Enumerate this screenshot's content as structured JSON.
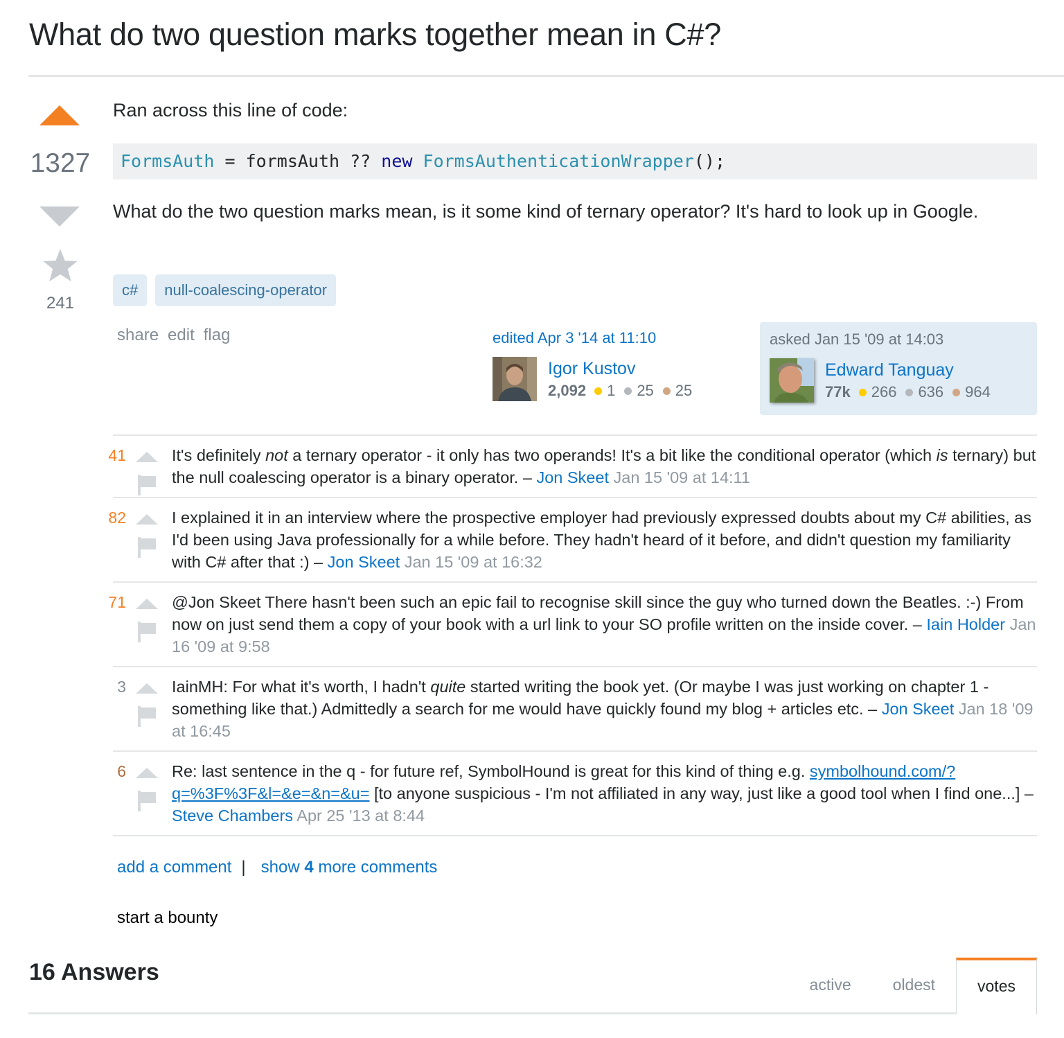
{
  "question": {
    "title": "What do two question marks together mean in C#?",
    "votes": "1327",
    "favorites": "241",
    "intro": "Ran across this line of code:",
    "code": {
      "part1": "FormsAuth",
      "part2": " = formsAuth ?? ",
      "part3": "new",
      "part4": " ",
      "part5": "FormsAuthenticationWrapper",
      "part6": "();"
    },
    "body": "What do the two question marks mean, is it some kind of ternary operator? It's hard to look up in Google.",
    "tags": [
      "c#",
      "null-coalescing-operator"
    ],
    "menu": {
      "share": "share",
      "edit": "edit",
      "flag": "flag"
    },
    "editor": {
      "label": "edited Apr 3 '14 at 11:10",
      "name": "Igor Kustov",
      "reputation": "2,092",
      "gold": "1",
      "silver": "25",
      "bronze": "25"
    },
    "owner": {
      "label": "asked Jan 15 '09 at 14:03",
      "name": "Edward Tanguay",
      "reputation": "77k",
      "gold": "266",
      "silver": "636",
      "bronze": "964"
    }
  },
  "comments": [
    {
      "score": "41",
      "text_a": "It's definitely ",
      "em_a": "not",
      "text_b": " a ternary operator - it only has two operands! It's a bit like the conditional operator (which ",
      "em_b": "is",
      "text_c": " ternary) but the null coalescing operator is a binary operator. – ",
      "user": "Jon Skeet",
      "date": "Jan 15 '09 at 14:11"
    },
    {
      "score": "82",
      "text": "I explained it in an interview where the prospective employer had previously expressed doubts about my C# abilities, as I'd been using Java professionally for a while before. They hadn't heard of it before, and didn't question my familiarity with C# after that :) – ",
      "user": "Jon Skeet",
      "date": "Jan 15 '09 at 16:32"
    },
    {
      "score": "71",
      "text": "@Jon Skeet There hasn't been such an epic fail to recognise skill since the guy who turned down the Beatles. :-) From now on just send them a copy of your book with a url link to your SO profile written on the inside cover. – ",
      "user": "Iain Holder",
      "date": "Jan 16 '09 at 9:58"
    },
    {
      "score": "3",
      "text_a": "IainMH: For what it's worth, I hadn't ",
      "em_a": "quite",
      "text_b": " started writing the book yet. (Or maybe I was just working on chapter 1 - something like that.) Admittedly a search for me would have quickly found my blog + articles etc. – ",
      "user": "Jon Skeet",
      "date": "Jan 18 '09 at 16:45"
    },
    {
      "score": "6",
      "text_a": "Re: last sentence in the q - for future ref, SymbolHound is great for this kind of thing e.g. ",
      "link": "symbolhound.com/?q=%3F%3F&l=&e=&n=&u=",
      "text_b": " [to anyone suspicious - I'm not affiliated in any way, just like a good tool when I find one...] – ",
      "user": "Steve Chambers",
      "date": "Apr 25 '13 at 8:44"
    }
  ],
  "comment_actions": {
    "add": "add a comment",
    "separator": "|",
    "show_prefix": "show ",
    "show_count": "4",
    "show_suffix": " more comments"
  },
  "bounty": "start a bounty",
  "answers": {
    "header": "16 Answers",
    "tabs": [
      "active",
      "oldest",
      "votes"
    ],
    "active_tab": "votes"
  },
  "colors": {
    "accent": "#f48024",
    "link": "#0c74c8",
    "tag_bg": "#e1ecf4",
    "tag_text": "#39739d"
  }
}
